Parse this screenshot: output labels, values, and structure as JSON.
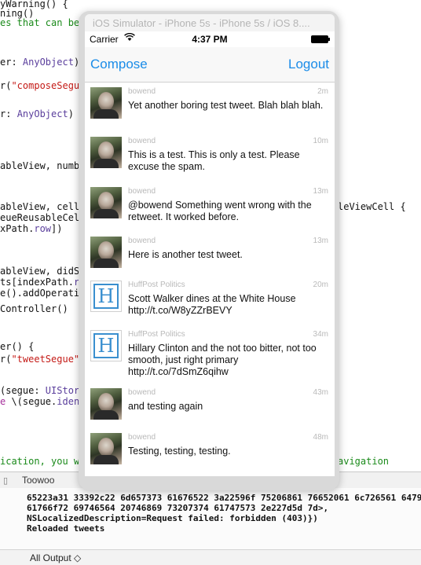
{
  "editor": {
    "lines": [
      {
        "cls": "",
        "html": "yWarning() {"
      },
      {
        "cls": "",
        "html": "ning()"
      },
      {
        "cls": "green",
        "html": "es that can be r"
      },
      {
        "cls": "",
        "html": "er: <span class='typ'>AnyObject</span>) {"
      },
      {
        "cls": "",
        "html": "r(<span class='str'>\"composeSegue\"</span>"
      },
      {
        "cls": "",
        "html": "r: <span class='typ'>AnyObject</span>) {"
      },
      {
        "cls": "",
        "html": "ableView, number"
      },
      {
        "cls": "",
        "html": "ableView, cellFo"
      },
      {
        "cls": "",
        "html": "eueReusableCellW"
      },
      {
        "cls": "",
        "html": "xPath.<span class='typ'>row</span>])"
      },
      {
        "cls": "",
        "html": "ableView, didSel"
      },
      {
        "cls": "",
        "html": "ts[indexPath.<span class='typ'>row</span>"
      },
      {
        "cls": "",
        "html": "e().addOperation"
      },
      {
        "cls": "",
        "html": "Controller()"
      },
      {
        "cls": "",
        "html": "er() {"
      },
      {
        "cls": "",
        "html": "r(<span class='str'>\"tweetSegue\"</span>,"
      },
      {
        "cls": "",
        "html": "(segue: <span class='typ'>UIStoryb</span>"
      },
      {
        "cls": "",
        "html": "<span class='kw'>e</span> \\(segue.<span class='typ'>identi</span>"
      },
      {
        "cls": "green",
        "html": "ication, you wil"
      }
    ],
    "right_lines": [
      {
        "html": "leViewCell {"
      },
      {
        "html": "avigation"
      }
    ]
  },
  "debug": {
    "process_name": "Toowoo"
  },
  "console": {
    "lines": [
      "65223a31 33392c22 6d657373 61676522 3a22596f 75206861 76652061 6c726561 6479",
      "61766f72 69746564 20746869 73207374 61747573 2e227d5d 7d>,",
      "NSLocalizedDescription=Request failed: forbidden (403)})",
      "Reloaded tweets"
    ],
    "output_selector": "All Output ◇"
  },
  "simulator": {
    "title": "iOS Simulator - iPhone 5s - iPhone 5s / iOS 8...."
  },
  "statusbar": {
    "carrier": "Carrier",
    "wifi_icon": "wifi-icon",
    "time": "4:37 PM",
    "battery_icon": "battery-icon"
  },
  "navbar": {
    "compose_label": "Compose",
    "logout_label": "Logout"
  },
  "tweets": [
    {
      "user": "bowend",
      "age": "2m",
      "avatar": "photo",
      "text": "Yet another boring test tweet. Blah blah blah."
    },
    {
      "user": "bowend",
      "age": "10m",
      "avatar": "photo",
      "text": "This is a test.  This is only a test.  Please excuse the spam."
    },
    {
      "user": "bowend",
      "age": "13m",
      "avatar": "photo",
      "text": "@bowend Something went wrong with the retweet.  It worked before."
    },
    {
      "user": "bowend",
      "age": "13m",
      "avatar": "photo",
      "text": "Here is another test tweet."
    },
    {
      "user": "HuffPost Politics",
      "age": "20m",
      "avatar": "hp",
      "text": "Scott Walker dines at the White House http://t.co/W8yZZrBEVY"
    },
    {
      "user": "HuffPost Politics",
      "age": "34m",
      "avatar": "hp",
      "text": "Hillary Clinton and the not too bitter, not too smooth, just right primary http://t.co/7dSmZ6qihw"
    },
    {
      "user": "bowend",
      "age": "43m",
      "avatar": "photo",
      "text": "and testing again"
    },
    {
      "user": "bowend",
      "age": "48m",
      "avatar": "photo",
      "text": "Testing, testing, testing."
    }
  ]
}
